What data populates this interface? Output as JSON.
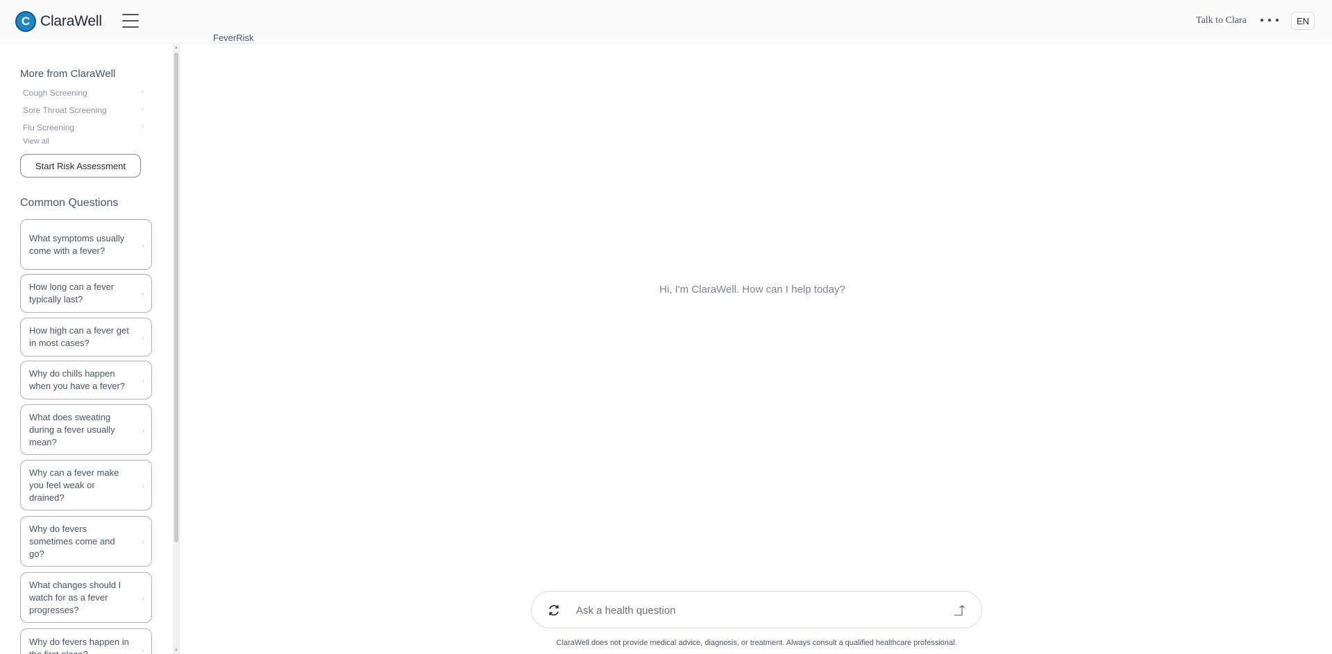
{
  "header": {
    "brand": "ClaraWell",
    "logo_letter": "C",
    "page_label": "FeverRisk",
    "talk_link": "Talk to Clara",
    "lang": "EN"
  },
  "sidebar": {
    "more_title": "More from ClaraWell",
    "links": [
      {
        "label": "Cough Screening"
      },
      {
        "label": "Sore Throat Screening"
      },
      {
        "label": "Flu Screening"
      }
    ],
    "view_all": "View all",
    "assess_button": "Start Risk Assessment",
    "questions_title": "Common Questions",
    "questions": [
      {
        "label": "What symptoms usually come with a fever?"
      },
      {
        "label": "How long can a fever typically last?"
      },
      {
        "label": "How high can a fever get in most cases?"
      },
      {
        "label": "Why do chills happen when you have a fever?"
      },
      {
        "label": "What does sweating during a fever usually mean?"
      },
      {
        "label": "Why can a fever make you feel weak or drained?"
      },
      {
        "label": "Why do fevers sometimes come and go?"
      },
      {
        "label": "What changes should I watch for as a fever progresses?"
      },
      {
        "label": "Why do fevers happen in the first place?"
      }
    ]
  },
  "main": {
    "greeting": "Hi, I'm ClaraWell. How can I help today?",
    "input_placeholder": "Ask a health question",
    "disclaimer": "ClaraWell does not provide medical advice, diagnosis, or treatment. Always consult a qualified healthcare professional."
  },
  "colors": {
    "brand_blue": "#1e86c7",
    "card_border": "#a9b1bf"
  }
}
